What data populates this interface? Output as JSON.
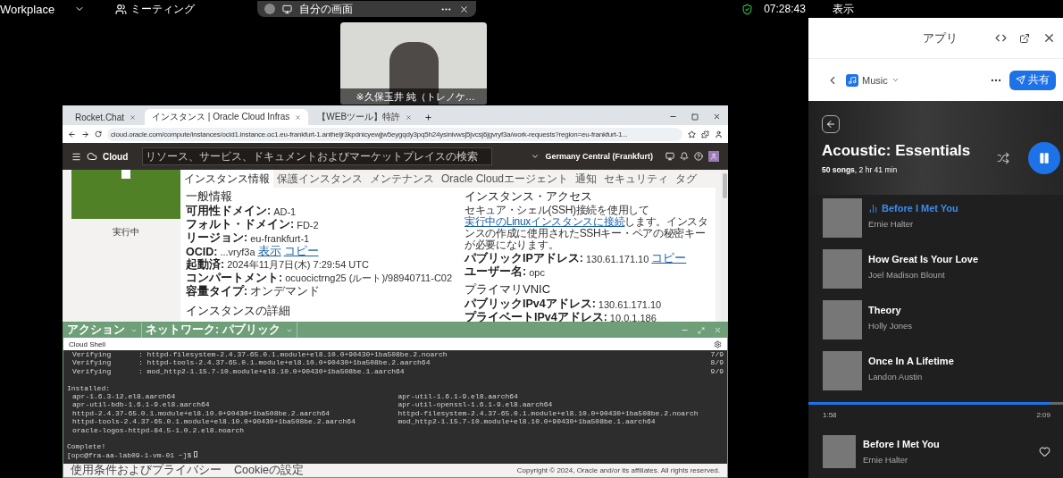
{
  "top_bar": {
    "app_name": "Workplace",
    "meeting": "ミーティング",
    "share_pill": {
      "label": "自分の画面"
    },
    "timer": "07:28:43",
    "view": "表示"
  },
  "video": {
    "caption": "※久保玉井 純（トレノケ…"
  },
  "browser": {
    "tabs": [
      {
        "label": "Rocket.Chat",
        "selected": false
      },
      {
        "label": "インスタンス | Oracle Cloud Infras",
        "selected": true
      },
      {
        "label": "【WEBツール】特許",
        "selected": false
      }
    ],
    "url": "cloud.oracle.com/compute/instances/ocid1.instance.oc1.eu-frankfurt-1.antheljr3kpdnicyewjjw5eygqdy3pq5h24ysinivwsj5jvcsj6jgvryf3a/work-requests?region=eu-frankfurt-1...",
    "console": {
      "logo": "Cloud",
      "search_placeholder": "リソース、サービス、ドキュメントおよびマーケットプレイスの検索",
      "region": "Germany Central (Frankfurt)"
    },
    "sidebar": {
      "status": "実行中"
    },
    "detail_tabs": [
      {
        "label": "インスタンス情報",
        "selected": true
      },
      {
        "label": "保護インスタンス",
        "selected": false
      },
      {
        "label": "メンテナンス",
        "selected": false
      },
      {
        "label": "Oracle Cloudエージェント",
        "selected": false
      },
      {
        "label": "通知",
        "selected": false
      },
      {
        "label": "セキュリティ",
        "selected": false
      },
      {
        "label": "タグ",
        "selected": false
      }
    ],
    "general": {
      "heading": "一般情報",
      "fields": [
        {
          "label": "可用性ドメイン:",
          "value": "AD-1"
        },
        {
          "label": "フォルト・ドメイン:",
          "value": "FD-2"
        },
        {
          "label": "リージョン:",
          "value": "eu-frankfurt-1"
        },
        {
          "label": "OCID:",
          "value": "...vryf3a",
          "links": [
            "表示",
            "コピー"
          ]
        },
        {
          "label": "起動済:",
          "value": "2024年11月7日(木) 7:29:54 UTC"
        },
        {
          "label": "コンパートメント:",
          "value": "ocuocictrng25 (ルート)/98940711-C02"
        },
        {
          "label": "容量タイプ:",
          "value": "オンデマンド"
        }
      ],
      "next_heading": "インスタンスの詳細"
    },
    "access": {
      "heading": "インスタンス・アクセス",
      "text_before": "セキュア・シェル(SSH)接続を使用して",
      "link": "実行中のLinuxインスタンスに接続",
      "text_after": "します。インスタンスの作成に使用されたSSHキー・ペアの秘密キーが必要になります。",
      "fields": [
        {
          "label": "パブリックIPアドレス:",
          "value": "130.61.171.10",
          "links": [
            "コピー"
          ]
        },
        {
          "label": "ユーザー名:",
          "value": "opc"
        }
      ]
    },
    "vnic": {
      "heading": "プライマリVNIC",
      "fields": [
        {
          "label": "パブリックIPv4アドレス:",
          "value": "130.61.171.10"
        },
        {
          "label": "プライベートIPv4アドレス:",
          "value": "10.0.1.186"
        }
      ]
    },
    "cloud_shell": {
      "action_menu": "アクション",
      "network_menu": "ネットワーク: パブリック",
      "title": "Cloud Shell",
      "verify_lines": [
        {
          "step": "Verifying",
          "package": ": httpd-filesystem-2.4.37-65.0.1.module+el8.10.0+90430+1ba508be.2.noarch",
          "count": "7/9"
        },
        {
          "step": "Verifying",
          "package": ": httpd-tools-2.4.37-65.0.1.module+el8.10.0+90430+1ba508be.2.aarch64",
          "count": "8/9"
        },
        {
          "step": "Verifying",
          "package": ": mod_http2-1.15.7-10.module+el8.10.0+90430+1ba508be.1.aarch64",
          "count": "9/9"
        }
      ],
      "installed_heading": "Installed:",
      "installed": [
        "apr-1.6.3-12.el8.aarch64",
        "apr-util-1.6.1-9.el8.aarch64",
        "apr-util-bdb-1.6.1-9.el8.aarch64",
        "apr-util-openssl-1.6.1-9.el8.aarch64",
        "httpd-2.4.37-65.0.1.module+el8.10.0+90430+1ba508be.2.aarch64",
        "httpd-filesystem-2.4.37-65.0.1.module+el8.10.0+90430+1ba508be.2.noarch",
        "httpd-tools-2.4.37-65.0.1.module+el8.10.0+90430+1ba508be.2.aarch64",
        "mod_http2-1.15.7-10.module+el8.10.0+90430+1ba508be.1.aarch64",
        "oracle-logos-httpd-84.5-1.0.2.el8.noarch"
      ],
      "complete": "Complete!",
      "prompt": "[opc@fra-aa-lab09-1-vm-01 ~]$"
    },
    "footer": {
      "links": [
        "使用条件およびプライバシー",
        "Cookieの設定"
      ],
      "copyright": "Copyright © 2024, Oracle and/or its affiliates. All rights reserved."
    }
  },
  "app_panel": {
    "title": "アプリ",
    "app_name": "Music",
    "share": "共有",
    "playlist": {
      "title": "Acoustic: Essentials",
      "meta": "**50 songs**, 2 hr 41 min"
    },
    "songs": [
      {
        "title": "Before I Met You",
        "artist": "Ernie Halter",
        "playing": true
      },
      {
        "title": "How Great Is Your Love",
        "artist": "Joel Madison Blount",
        "playing": false
      },
      {
        "title": "Theory",
        "artist": "Holly Jones",
        "playing": false
      },
      {
        "title": "Once In A Lifetime",
        "artist": "Landon Austin",
        "playing": false
      }
    ],
    "progress": {
      "level": 0.95,
      "elapsed": "1:58",
      "total": "2:09"
    },
    "now_playing": {
      "title": "Before I Met You",
      "artist": "Ernie Halter"
    }
  }
}
